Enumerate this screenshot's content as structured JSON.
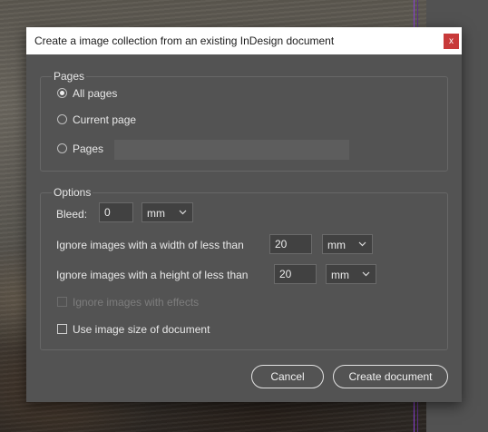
{
  "dialog": {
    "title": "Create a image collection from an existing InDesign document",
    "close_label": "x"
  },
  "pages_group": {
    "label": "Pages",
    "all_pages": "All pages",
    "current_page": "Current page",
    "pages": "Pages",
    "pages_input_value": "",
    "selected": "All pages"
  },
  "options_group": {
    "label": "Options",
    "bleed_label": "Bleed:",
    "bleed_value": "0",
    "bleed_unit": "mm",
    "width_label": "Ignore images with a width of less than",
    "width_value": "20",
    "width_unit": "mm",
    "height_label": "Ignore images with a height of less than",
    "height_value": "20",
    "height_unit": "mm",
    "ignore_effects_label": "Ignore images with effects",
    "ignore_effects_checked": false,
    "use_size_label": "Use image size of document",
    "use_size_checked": false
  },
  "buttons": {
    "cancel": "Cancel",
    "create": "Create document"
  },
  "colors": {
    "dialog_bg": "#535353",
    "close_button": "#c83a3a",
    "guide_line": "#8a3fd1"
  }
}
